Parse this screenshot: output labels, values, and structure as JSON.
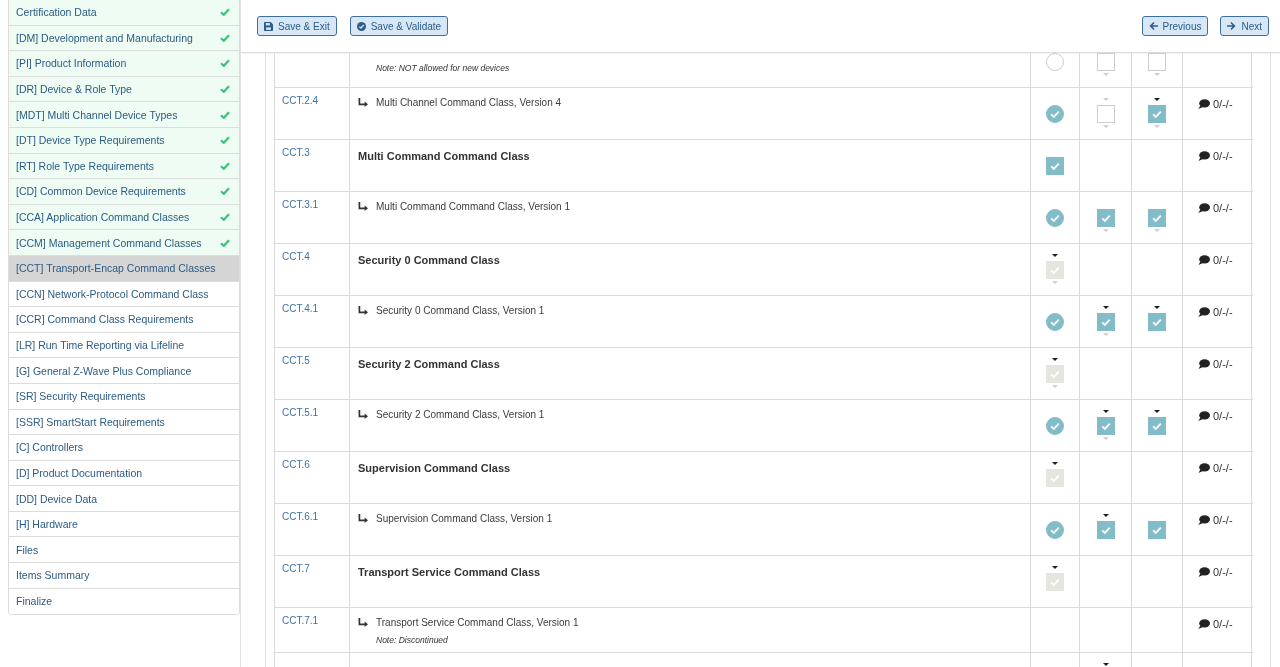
{
  "sidebar": {
    "items": [
      {
        "label": "Certification Data",
        "done": true,
        "selected": false
      },
      {
        "label": "[DM] Development and Manufacturing",
        "done": true,
        "selected": false
      },
      {
        "label": "[PI] Product Information",
        "done": true,
        "selected": false
      },
      {
        "label": "[DR] Device & Role Type",
        "done": true,
        "selected": false
      },
      {
        "label": "[MDT] Multi Channel Device Types",
        "done": true,
        "selected": false
      },
      {
        "label": "[DT] Device Type Requirements",
        "done": true,
        "selected": false
      },
      {
        "label": "[RT] Role Type Requirements",
        "done": true,
        "selected": false
      },
      {
        "label": "[CD] Common Device Requirements",
        "done": true,
        "selected": false
      },
      {
        "label": "[CCA] Application Command Classes",
        "done": true,
        "selected": false
      },
      {
        "label": "[CCM] Management Command Classes",
        "done": true,
        "selected": false
      },
      {
        "label": "[CCT] Transport-Encap Command Classes",
        "done": false,
        "selected": true
      },
      {
        "label": "[CCN] Network-Protocol Command Class",
        "done": false,
        "selected": false
      },
      {
        "label": "[CCR] Command Class Requirements",
        "done": false,
        "selected": false
      },
      {
        "label": "[LR] Run Time Reporting via Lifeline",
        "done": false,
        "selected": false
      },
      {
        "label": "[G] General Z-Wave Plus Compliance",
        "done": false,
        "selected": false
      },
      {
        "label": "[SR] Security Requirements",
        "done": false,
        "selected": false
      },
      {
        "label": "[SSR] SmartStart Requirements",
        "done": false,
        "selected": false
      },
      {
        "label": "[C] Controllers",
        "done": false,
        "selected": false
      },
      {
        "label": "[D] Product Documentation",
        "done": false,
        "selected": false
      },
      {
        "label": "[DD] Device Data",
        "done": false,
        "selected": false
      },
      {
        "label": "[H] Hardware",
        "done": false,
        "selected": false
      },
      {
        "label": "Files",
        "done": false,
        "selected": false
      },
      {
        "label": "Items Summary",
        "done": false,
        "selected": false
      },
      {
        "label": "Finalize",
        "done": false,
        "selected": false
      }
    ]
  },
  "toolbar": {
    "left": [
      {
        "kind": "save_exit",
        "label": "Save & Exit"
      },
      {
        "kind": "save_validate",
        "label": "Save & Validate"
      }
    ],
    "right": [
      {
        "kind": "previous",
        "label": "Previous"
      },
      {
        "kind": "next",
        "label": "Next"
      }
    ]
  },
  "table": {
    "rows": [
      {
        "kind": "version",
        "note": "Note: NOT allowed for new devices",
        "cells": [
          {
            "kind": "circle",
            "checked": false,
            "disabled": false,
            "caret_above": false,
            "caret_below": false
          },
          {
            "kind": "box",
            "checked": false,
            "disabled": false,
            "caret_above": false,
            "caret_below": true,
            "caret_below_warm": false
          },
          {
            "kind": "box",
            "checked": false,
            "disabled": false,
            "caret_above": false,
            "caret_below": true,
            "caret_below_warm": false
          }
        ]
      },
      {
        "id": "CCT.2.4",
        "kind": "version",
        "title": "Multi Channel Command Class, Version 4",
        "cells": [
          {
            "kind": "circle",
            "checked": true,
            "disabled": false,
            "caret_above": false,
            "caret_below": false
          },
          {
            "kind": "box",
            "checked": false,
            "disabled": false,
            "caret_above": true,
            "caret_above_dark": false,
            "caret_below": true,
            "caret_below_warm": false
          },
          {
            "kind": "box",
            "checked": true,
            "disabled": false,
            "caret_above": true,
            "caret_above_dark": true,
            "caret_below": true,
            "caret_below_warm": false
          }
        ],
        "comment": "0/-/-"
      },
      {
        "id": "CCT.3",
        "kind": "class",
        "title": "Multi Command Command Class",
        "cells": [
          {
            "kind": "box",
            "checked": true,
            "disabled": false,
            "caret_above": false,
            "caret_below": false
          },
          null,
          null
        ],
        "comment": "0/-/-"
      },
      {
        "id": "CCT.3.1",
        "kind": "version",
        "title": "Multi Command Command Class, Version 1",
        "cells": [
          {
            "kind": "circle",
            "checked": true,
            "disabled": false,
            "caret_above": false,
            "caret_below": false
          },
          {
            "kind": "box",
            "checked": true,
            "disabled": false,
            "caret_above": false,
            "caret_below": true,
            "caret_below_warm": true
          },
          {
            "kind": "box",
            "checked": true,
            "disabled": false,
            "caret_above": false,
            "caret_below": true,
            "caret_below_warm": false
          }
        ],
        "comment": "0/-/-"
      },
      {
        "id": "CCT.4",
        "kind": "class",
        "title": "Security 0 Command Class",
        "cells": [
          {
            "kind": "box",
            "checked": true,
            "disabled": true,
            "caret_above": true,
            "caret_above_dark": true,
            "caret_below": true,
            "caret_below_warm": false
          },
          null,
          null
        ],
        "comment": "0/-/-"
      },
      {
        "id": "CCT.4.1",
        "kind": "version",
        "title": "Security 0 Command Class, Version 1",
        "cells": [
          {
            "kind": "circle",
            "checked": true,
            "disabled": false,
            "caret_above": false,
            "caret_below": false
          },
          {
            "kind": "box",
            "checked": true,
            "disabled": false,
            "caret_above": true,
            "caret_above_dark": true,
            "caret_below": true,
            "caret_below_warm": true
          },
          {
            "kind": "box",
            "checked": true,
            "disabled": false,
            "caret_above": true,
            "caret_above_dark": true,
            "caret_below": false
          }
        ],
        "comment": "0/-/-"
      },
      {
        "id": "CCT.5",
        "kind": "class",
        "title": "Security 2 Command Class",
        "cells": [
          {
            "kind": "box",
            "checked": true,
            "disabled": true,
            "caret_above": true,
            "caret_above_dark": true,
            "caret_below": true,
            "caret_below_warm": false
          },
          null,
          null
        ],
        "comment": "0/-/-"
      },
      {
        "id": "CCT.5.1",
        "kind": "version",
        "title": "Security 2 Command Class, Version 1",
        "cells": [
          {
            "kind": "circle",
            "checked": true,
            "disabled": false,
            "caret_above": false,
            "caret_below": false
          },
          {
            "kind": "box",
            "checked": true,
            "disabled": false,
            "caret_above": true,
            "caret_above_dark": true,
            "caret_below": true,
            "caret_below_warm": true
          },
          {
            "kind": "box",
            "checked": true,
            "disabled": false,
            "caret_above": true,
            "caret_above_dark": true,
            "caret_below": false
          }
        ],
        "comment": "0/-/-"
      },
      {
        "id": "CCT.6",
        "kind": "class",
        "title": "Supervision Command Class",
        "cells": [
          {
            "kind": "box",
            "checked": true,
            "disabled": true,
            "caret_above": true,
            "caret_above_dark": true,
            "caret_below": false
          },
          null,
          null
        ],
        "comment": "0/-/-"
      },
      {
        "id": "CCT.6.1",
        "kind": "version",
        "title": "Supervision Command Class, Version 1",
        "cells": [
          {
            "kind": "circle",
            "checked": true,
            "disabled": false,
            "caret_above": false,
            "caret_below": false
          },
          {
            "kind": "box",
            "checked": true,
            "disabled": false,
            "caret_above": true,
            "caret_above_dark": true,
            "caret_below": false
          },
          {
            "kind": "box",
            "checked": true,
            "disabled": false,
            "caret_above": false,
            "caret_below": false
          }
        ],
        "comment": "0/-/-"
      },
      {
        "id": "CCT.7",
        "kind": "class",
        "title": "Transport Service Command Class",
        "cells": [
          {
            "kind": "box",
            "checked": true,
            "disabled": true,
            "caret_above": true,
            "caret_above_dark": true,
            "caret_below": false
          },
          null,
          null
        ],
        "comment": "0/-/-"
      },
      {
        "id": "CCT.7.1",
        "kind": "version",
        "title": "Transport Service Command Class, Version 1",
        "note": "Note: Discontinued",
        "cells": [
          null,
          null,
          null
        ],
        "comment": "0/-/-"
      },
      {
        "kind": "version",
        "cells": [
          null,
          {
            "caret_above": true,
            "caret_above_dark": true,
            "caret_below": false
          },
          null
        ]
      }
    ]
  }
}
